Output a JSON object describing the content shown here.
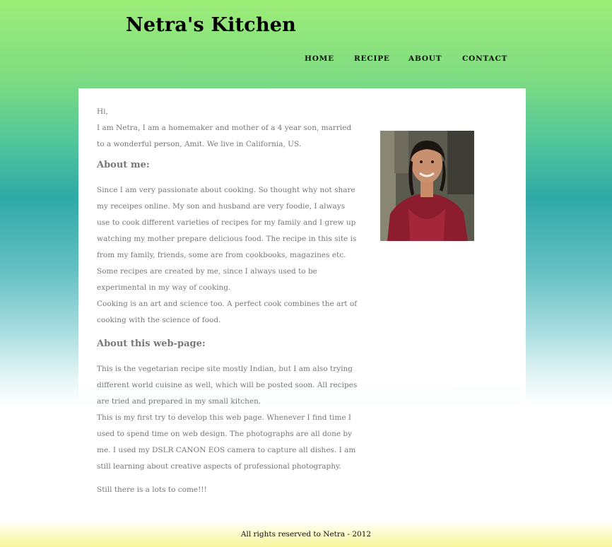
{
  "header": {
    "site_title": "Netra's Kitchen"
  },
  "nav": {
    "home": "HOME",
    "recipe": "RECIPE",
    "about": "ABOUT",
    "contact": "CONTACT"
  },
  "main": {
    "greeting": "Hi,",
    "intro": "I am Netra, I am a homemaker and mother of a 4 year son, married to a wonderful person, Amit. We live in California, US.",
    "about_heading": "About me:",
    "about_p1": "Since I am very passionate about cooking. So thought why not share my receipes online. My son and husband are very foodie, I always use to cook different varieties of recipes for my family and I grew up watching my mother prepare delicious food. The recipe in this site is from my family, friends, some are from cookbooks, magazines etc. Some recipes are created by me, since I always used to be experimental in my way of cooking.",
    "about_p2": "Cooking is an art and science too. A perfect cook combines the art of cooking with the science of food.",
    "web_heading": "About this web-page:",
    "web_p1": "This is the vegetarian recipe site mostly Indian, but I am also trying different world cuisine as well, which will be posted soon. All recipes are tried and prepared in my small kitchen.",
    "web_p2": "This is my first try to develop this web page. Whenever I find time I used to spend time on web design. The photographs are all done by me. I used my DSLR CANON EOS camera to capture all dishes. I am still learning about creative aspects of professional photography.",
    "closing": "Still there is a lots to come!!!"
  },
  "footer": {
    "text": "All rights reserved to Netra - 2012"
  },
  "colors": {
    "top_green": "#9ded78",
    "teal": "#2fa9a7",
    "footer_yellow": "#f6f597",
    "body_text": "#777777"
  }
}
